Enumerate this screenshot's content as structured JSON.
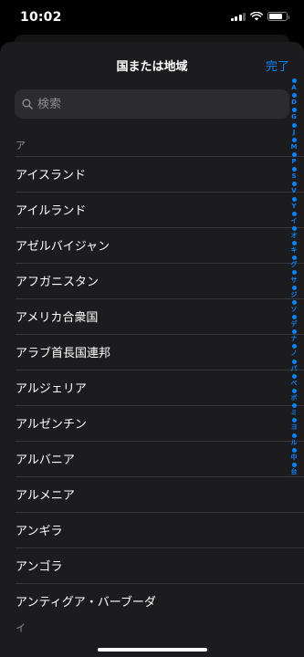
{
  "status_bar": {
    "time": "10:02",
    "battery_level": 0.85,
    "signal_bars": 4
  },
  "sheet": {
    "title": "国または地域",
    "done_label": "完了",
    "search_placeholder": "検索"
  },
  "sections": [
    {
      "header": "ア",
      "items": [
        "アイスランド",
        "アイルランド",
        "アゼルバイジャン",
        "アフガニスタン",
        "アメリカ合衆国",
        "アラブ首長国連邦",
        "アルジェリア",
        "アルゼンチン",
        "アルバニア",
        "アルメニア",
        "アンギラ",
        "アンゴラ",
        "アンティグア・バーブーダ"
      ]
    },
    {
      "header": "イ",
      "items": []
    }
  ],
  "index_entries": [
    "A",
    "D",
    "G",
    "J",
    "M",
    "P",
    "S",
    "V",
    "Y",
    "イ",
    "オ",
    "キ",
    "グ",
    "サ",
    "ジ",
    "ソ",
    "デ",
    "ナ",
    "ノ",
    "パ",
    "ベ",
    "ボ",
    "ミ",
    "ヨ",
    "ル",
    "中",
    "台"
  ],
  "colors": {
    "accent": "#0a84ff",
    "sheet_background": "#1c1c1e",
    "search_background": "#2c2c2e"
  }
}
